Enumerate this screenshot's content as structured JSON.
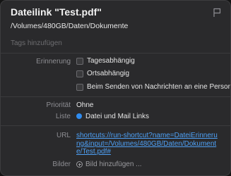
{
  "header": {
    "title": "Dateilink \"Test.pdf\"",
    "subtitle": "/Volumes/480GB/Daten/Dokumente",
    "flag_icon": "flag-icon"
  },
  "tags": {
    "placeholder": "Tags hinzufügen"
  },
  "reminder": {
    "label": "Erinnerung",
    "options": [
      {
        "label": "Tagesabhängig",
        "checked": false
      },
      {
        "label": "Ortsabhängig",
        "checked": false
      },
      {
        "label": "Beim Senden von Nachrichten an eine Person",
        "checked": false
      }
    ]
  },
  "priority": {
    "label": "Priorität",
    "value": "Ohne"
  },
  "list": {
    "label": "Liste",
    "value": "Datei und Mail Links",
    "color": "#2f8cf0"
  },
  "url": {
    "label": "URL",
    "value": "shortcuts://run-shortcut?name=DateiErinnerung&input=/Volumes/480GB/Daten/Dokumente/Test.pdf#"
  },
  "images": {
    "label": "Bilder",
    "add_label": "Bild hinzufügen ..."
  }
}
